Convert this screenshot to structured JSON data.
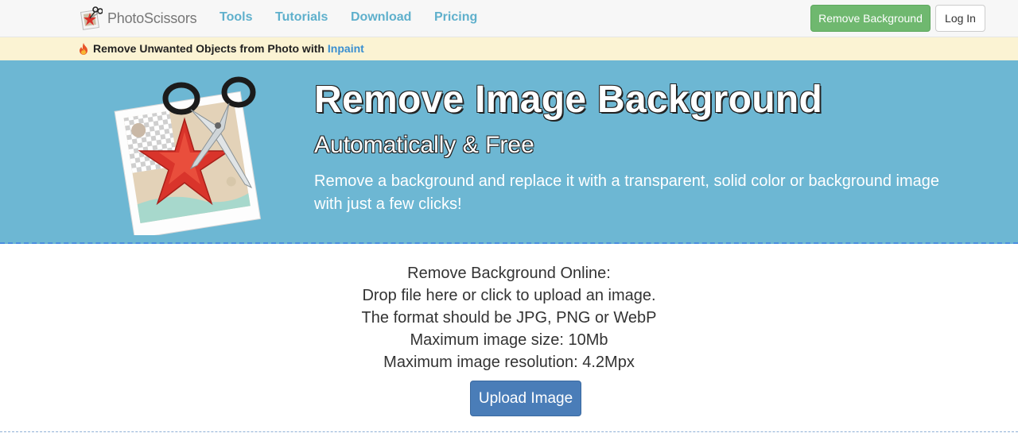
{
  "navbar": {
    "brand": "PhotoScissors",
    "links": [
      "Tools",
      "Tutorials",
      "Download",
      "Pricing"
    ],
    "remove_background_button": "Remove Background",
    "login_button": "Log In"
  },
  "promo": {
    "text": "Remove Unwanted Objects from Photo with",
    "link": "Inpaint",
    "icon": "fire-icon"
  },
  "hero": {
    "title": "Remove Image Background",
    "subtitle": "Automatically & Free",
    "description": "Remove a background and replace it with a transparent, solid color or background image with just a few clicks!"
  },
  "upload": {
    "lines": [
      "Remove Background Online:",
      "Drop file here or click to upload an image.",
      "The format should be JPG, PNG or WebP",
      "Maximum image size: 10Mb",
      "Maximum image resolution: 4.2Mpx"
    ],
    "button": "Upload Image"
  },
  "colors": {
    "hero_bg": "#6db7d3",
    "nav_link": "#5fb0cc",
    "green_button": "#6fb86f",
    "upload_button": "#4a7db8",
    "promo_bg": "#fbf3d3"
  }
}
